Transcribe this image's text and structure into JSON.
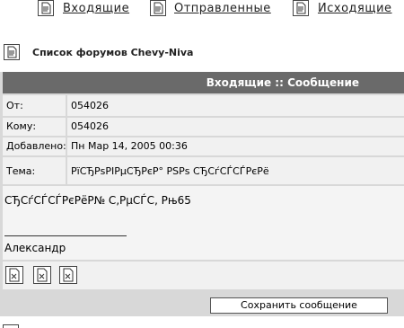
{
  "top_nav": {
    "inbox": "Входящие",
    "sent": "Отправленные",
    "outbox": "Исходящие"
  },
  "forum_link": "Список форумов Chevy-Niva",
  "message": {
    "header": "Входящие :: Сообщение",
    "rows": [
      {
        "label": "От:",
        "value": "054026"
      },
      {
        "label": "Кому:",
        "value": "054026"
      },
      {
        "label": "Добавлено:",
        "value": "Пн Мар 14, 2005 00:36"
      },
      {
        "label": "Тема:",
        "value": "РїСЂРѕРІРµСЂРєР° РЅРѕ СЂСѓСЃСЃРєРё"
      }
    ],
    "body_text": "СЂСѓСЃСЃРєРёР№ С‚РµСЃС‚ Рњ65",
    "signature": "Александр"
  },
  "save_button": "Сохранить сообщение",
  "icons": {
    "nav": "document-icon",
    "action": "edit-icon"
  }
}
